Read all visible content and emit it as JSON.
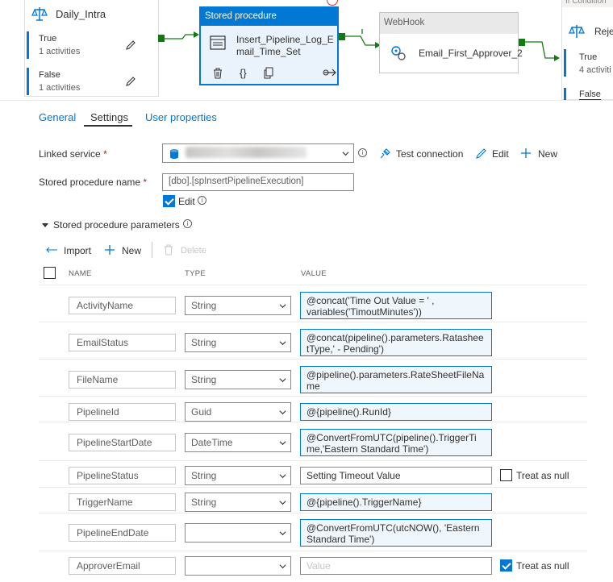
{
  "canvas": {
    "if_activity": {
      "title": "Daily_Intra",
      "branches": [
        {
          "label": "True",
          "sub": "1 activities"
        },
        {
          "label": "False",
          "sub": "1 activities"
        }
      ]
    },
    "stored_procedure_activity": {
      "header": "Stored procedure",
      "name": "Insert_Pipeline_Log_Email_Time_Set"
    },
    "webhook_activity": {
      "header": "WebHook",
      "name": "Email_First_Approver_2"
    },
    "if_condition_2": {
      "header": "If Condition",
      "title": "Reje",
      "branches": [
        {
          "label": "True",
          "sub": "4 activiti"
        },
        {
          "label": "False",
          "sub": ""
        }
      ]
    }
  },
  "tabs": [
    {
      "label": "General",
      "active": false
    },
    {
      "label": "Settings",
      "active": true
    },
    {
      "label": "User properties",
      "active": false
    }
  ],
  "form": {
    "linked_service_label": "Linked service",
    "test_connection": "Test connection",
    "edit": "Edit",
    "new": "New",
    "sp_name_label": "Stored procedure name",
    "sp_name_value": "[dbo].[spInsertPipelineExecution]",
    "edit_checkbox_label": "Edit",
    "params_section": "Stored procedure parameters"
  },
  "params_toolbar": {
    "import": "Import",
    "new": "New",
    "delete": "Delete"
  },
  "table_headers": {
    "name": "NAME",
    "type": "TYPE",
    "value": "VALUE"
  },
  "params": [
    {
      "name": "ActivityName",
      "type": "String",
      "value": "@concat('Time Out Value = ' , variables('TimoutMinutes'))",
      "lines": [
        "@concat('Time Out Value = ' ,",
        "variables('TimoutMinutes'))"
      ],
      "dynamic": true
    },
    {
      "name": "EmailStatus",
      "type": "String",
      "value": "@concat(pipeline().parameters.RatesheetType,' - Pending')",
      "lines": [
        "@concat(pipeline().parameters.Ratashee",
        "tType,' - Pending')"
      ],
      "dynamic": true
    },
    {
      "name": "FileName",
      "type": "String",
      "value": "@pipeline().parameters.RateSheetFileName",
      "lines": [
        "@pipeline().parameters.RateSheetFileNa",
        "me"
      ],
      "dynamic": true
    },
    {
      "name": "PipelineId",
      "type": "Guid",
      "value": "@{pipeline().RunId}",
      "lines": [
        "@{pipeline().RunId}"
      ],
      "dynamic": true
    },
    {
      "name": "PipelineStartDate",
      "type": "DateTime",
      "value": "@ConvertFromUTC(pipeline().TriggerTime,'Eastern Standard Time')",
      "lines": [
        "@ConvertFromUTC(pipeline().TriggerTi",
        "me,'Eastern Standard Time')"
      ],
      "dynamic": true
    },
    {
      "name": "PipelineStatus",
      "type": "String",
      "value": "Setting Timeout Value",
      "lines": [
        "Setting Timeout Value"
      ],
      "dynamic": false,
      "treat_as_null": false,
      "treat_as_null_label": "Treat as null"
    },
    {
      "name": "TriggerName",
      "type": "String",
      "value": "@{pipeline().TriggerName}",
      "lines": [
        "@{pipeline().TriggerName}"
      ],
      "dynamic": true
    },
    {
      "name": "PipelineEndDate",
      "type": "",
      "value": "@ConvertFromUTC(utcNOW(), 'Eastern Standard Time')",
      "lines": [
        "@ConvertFromUTC(utcNOW(), 'Eastern",
        "Standard Time')"
      ],
      "dynamic": true
    },
    {
      "name": "ApproverEmail",
      "type": "",
      "value": "",
      "placeholder": "Value",
      "lines": [
        "Value"
      ],
      "dynamic": false,
      "treat_as_null": true,
      "treat_as_null_label": "Treat as null"
    }
  ],
  "colors": {
    "accent": "#0078d4",
    "success": "#107c10",
    "dynamic_bg": "#eff6fc"
  }
}
